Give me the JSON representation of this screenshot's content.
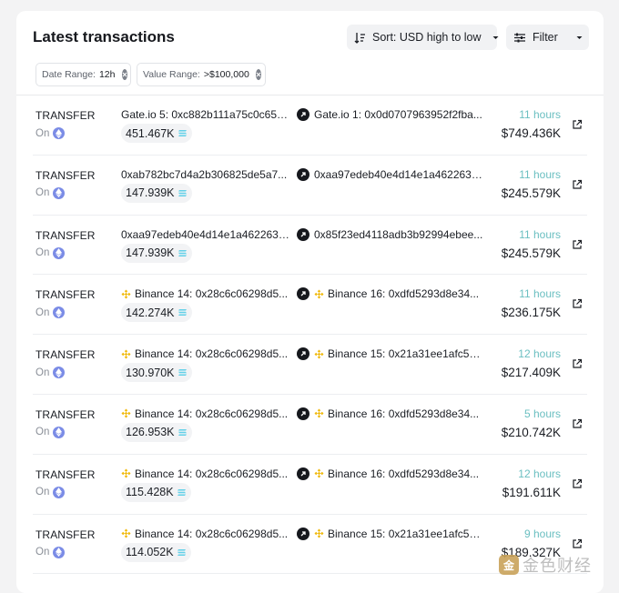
{
  "header": {
    "title": "Latest transactions",
    "sort_label": "Sort: USD high to low",
    "filter_label": "Filter",
    "colors": {
      "accent_time": "#6bbfc1",
      "filter_dot": "#ee6969"
    }
  },
  "filters": [
    {
      "key": "Date Range:",
      "value": "12h"
    },
    {
      "key": "Value Range:",
      "value": ">$100,000"
    }
  ],
  "transactions": [
    {
      "type": "TRANSFER",
      "chain": "On",
      "from": "Gate.io 5: 0xc882b111a75c0c657f...",
      "from_icon": "",
      "to": "Gate.io 1: 0x0d0707963952f2fba...",
      "to_icon": "",
      "amount": "451.467K",
      "time": "11 hours",
      "usd": "$749.436K"
    },
    {
      "type": "TRANSFER",
      "chain": "On",
      "from": "0xab782bc7d4a2b306825de5a7...",
      "from_icon": "",
      "to": "0xaa97edeb40e4d14e1a462263d...",
      "to_icon": "",
      "amount": "147.939K",
      "time": "11 hours",
      "usd": "$245.579K"
    },
    {
      "type": "TRANSFER",
      "chain": "On",
      "from": "0xaa97edeb40e4d14e1a462263d...",
      "from_icon": "",
      "to": "0x85f23ed4118adb3b92994ebee...",
      "to_icon": "",
      "amount": "147.939K",
      "time": "11 hours",
      "usd": "$245.579K"
    },
    {
      "type": "TRANSFER",
      "chain": "On",
      "from": "Binance 14: 0x28c6c06298d5...",
      "from_icon": "binance",
      "to": "Binance 16: 0xdfd5293d8e34...",
      "to_icon": "binance",
      "amount": "142.274K",
      "time": "11 hours",
      "usd": "$236.175K"
    },
    {
      "type": "TRANSFER",
      "chain": "On",
      "from": "Binance 14: 0x28c6c06298d5...",
      "from_icon": "binance",
      "to": "Binance 15: 0x21a31ee1afc51d...",
      "to_icon": "binance",
      "amount": "130.970K",
      "time": "12 hours",
      "usd": "$217.409K"
    },
    {
      "type": "TRANSFER",
      "chain": "On",
      "from": "Binance 14: 0x28c6c06298d5...",
      "from_icon": "binance",
      "to": "Binance 16: 0xdfd5293d8e34...",
      "to_icon": "binance",
      "amount": "126.953K",
      "time": "5 hours",
      "usd": "$210.742K"
    },
    {
      "type": "TRANSFER",
      "chain": "On",
      "from": "Binance 14: 0x28c6c06298d5...",
      "from_icon": "binance",
      "to": "Binance 16: 0xdfd5293d8e34...",
      "to_icon": "binance",
      "amount": "115.428K",
      "time": "12 hours",
      "usd": "$191.611K"
    },
    {
      "type": "TRANSFER",
      "chain": "On",
      "from": "Binance 14: 0x28c6c06298d5...",
      "from_icon": "binance",
      "to": "Binance 15: 0x21a31ee1afc51d...",
      "to_icon": "binance",
      "amount": "114.052K",
      "time": "9 hours",
      "usd": "$189.327K"
    }
  ],
  "watermark": {
    "text": "金色财经",
    "logo_char": "金"
  }
}
